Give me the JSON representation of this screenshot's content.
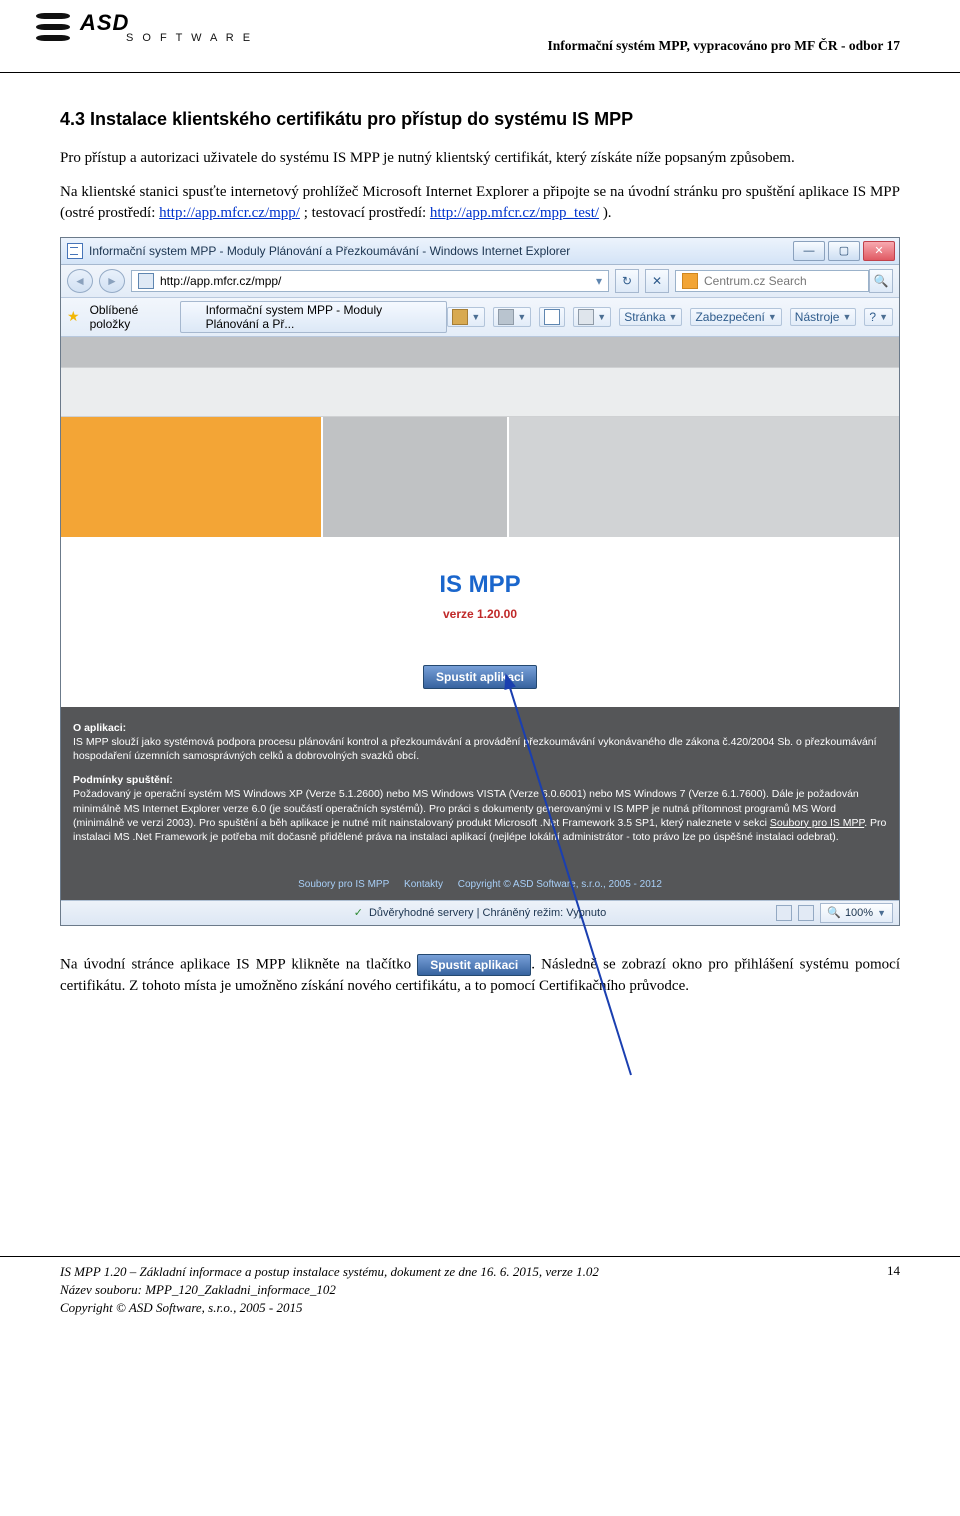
{
  "header": {
    "logo_text": "ASD",
    "logo_sub": "S O F T W A R E",
    "right": "Informační systém MPP, vypracováno pro MF ČR - odbor 17"
  },
  "section": {
    "heading": "4.3 Instalace klientského certifikátu pro přístup do systému IS MPP",
    "p1": "Pro přístup a autorizaci uživatele do systému IS MPP je nutný klientský certifikát, který získáte níže popsaným způsobem.",
    "p2a": "Na klientské stanici spusťte internetový prohlížeč Microsoft Internet Explorer a připojte se na úvodní stránku pro spuštění aplikace IS MPP (ostré prostředí: ",
    "p2_link1": "http://app.mfcr.cz/mpp/",
    "p2b": " ; testovací prostředí: ",
    "p2_link2": "http://app.mfcr.cz/mpp_test/",
    "p2c": " )."
  },
  "ie": {
    "title": "Informační system MPP - Moduly Plánování a Přezkoumávání - Windows Internet Explorer",
    "url": "http://app.mfcr.cz/mpp/",
    "search_placeholder": "Centrum.cz Search",
    "fav_label": "Oblíbené položky",
    "tab_label": "Informační system MPP - Moduly Plánování a Př...",
    "tools": {
      "page": "Stránka",
      "safety": "Zabezpečení",
      "tools": "Nástroje"
    },
    "ismpp": {
      "title": "IS MPP",
      "version": "verze 1.20.00",
      "run": "Spustit aplikaci"
    },
    "dark": {
      "h1": "O aplikaci:",
      "t1": "IS MPP slouží jako systémová podpora procesu plánování kontrol a přezkoumávání a provádění přezkoumávání vykonávaného dle zákona č.420/2004 Sb. o přezkoumávání hospodaření územních samosprávných celků a dobrovolných svazků obcí.",
      "h2": "Podmínky spuštění:",
      "t2a": "Požadovaný je operační systém MS Windows XP (Verze 5.1.2600) nebo MS Windows VISTA (Verze 6.0.6001) nebo MS Windows 7 (Verze 6.1.7600). Dále je požadován minimálně MS Internet Explorer verze 6.0 (je součástí operačních systémů). Pro práci s dokumenty generovanými v IS MPP je nutná přítomnost programů MS Word (minimálně ve verzi 2003). Pro spuštění a běh aplikace je nutné mít nainstalovaný produkt Microsoft .Net Framework 3.5 SP1, který naleznete v sekci ",
      "t2_link": "Soubory pro IS MPP",
      "t2b": ". Pro instalaci MS .Net Framework je potřeba mít dočasně přidělené práva na instalaci aplikací (nejlépe lokální administrátor - toto právo lze po úspěšné instalaci odebrat).",
      "links": {
        "a": "Soubory pro IS MPP",
        "b": "Kontakty",
        "c": "Copyright © ASD Software, s.r.o., 2005 - 2012"
      }
    },
    "status": {
      "text": "Důvěryhodné servery | Chráněný režim: Vypnuto",
      "zoom": "100%"
    }
  },
  "after": {
    "p_a": "Na úvodní stránce aplikace IS MPP klikněte na tlačítko ",
    "btn": "Spustit aplikaci",
    "p_b": ". Následně se zobrazí okno pro přihlášení systému pomocí certifikátu. Z tohoto místa je umožněno získání nového certifikátu, a to pomocí Certifikačního průvodce."
  },
  "footer": {
    "l1": "IS MPP 1.20 – Základní informace a postup instalace systému, dokument ze dne 16. 6. 2015, verze 1.02",
    "l2": "Název souboru: MPP_120_Zakladni_informace_102",
    "l3": "Copyright © ASD Software, s.r.o., 2005 - 2015",
    "page": "14"
  }
}
